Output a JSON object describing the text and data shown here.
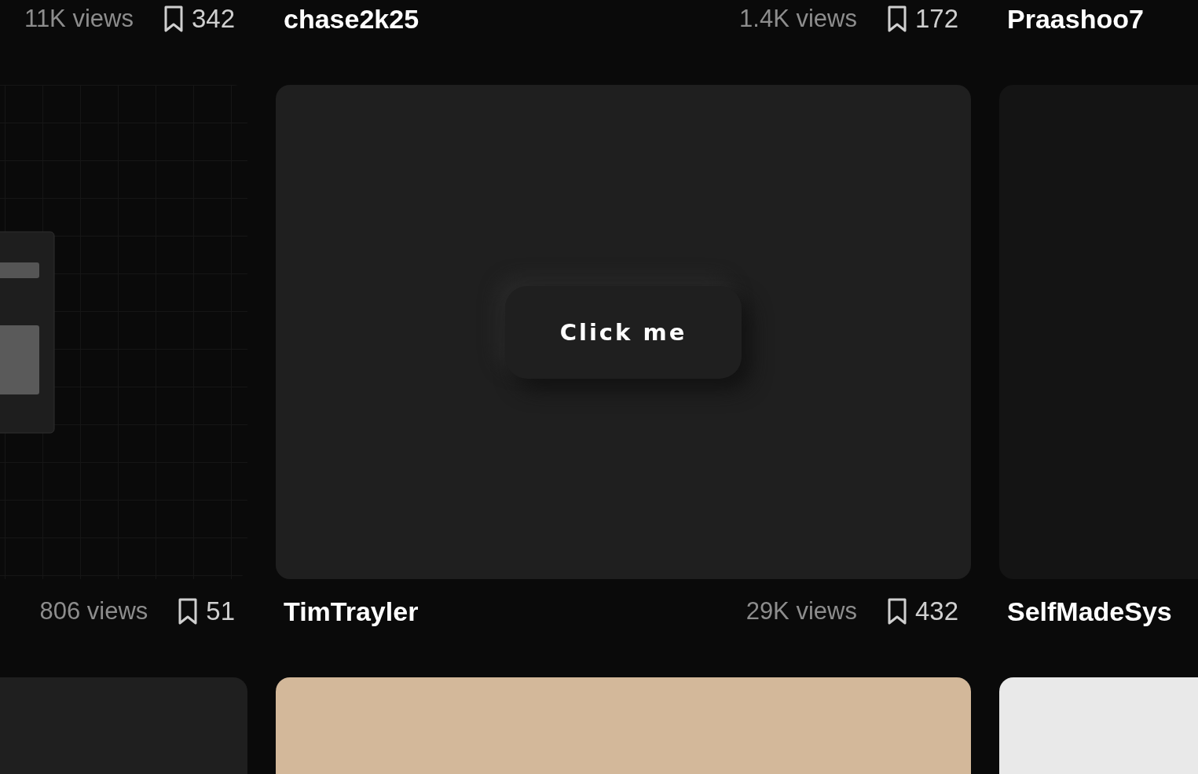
{
  "sections": [
    {
      "kind": "meta",
      "items": [
        {
          "views": "11K views",
          "saves": "342"
        },
        {
          "author": "chase2k25",
          "views": "1.4K views",
          "saves": "172"
        },
        {
          "author": "Praashoo7"
        }
      ]
    },
    {
      "kind": "cards",
      "items": [
        {
          "kind": "mockup",
          "color": "#0a0a0a"
        },
        {
          "kind": "button",
          "color": "#1f1f1f",
          "button_label": "Click me"
        },
        {
          "kind": "blank",
          "color": "#141414"
        }
      ]
    },
    {
      "kind": "meta",
      "items": [
        {
          "views": "806 views",
          "saves": "51"
        },
        {
          "author": "TimTrayler",
          "views": "29K views",
          "saves": "432"
        },
        {
          "author": "SelfMadeSys"
        }
      ]
    },
    {
      "kind": "cards",
      "items": [
        {
          "kind": "blank",
          "color": "#1f1f1f"
        },
        {
          "kind": "blank",
          "color": "#d3b89a"
        },
        {
          "kind": "blank",
          "color": "#e9e9e9"
        }
      ]
    }
  ]
}
